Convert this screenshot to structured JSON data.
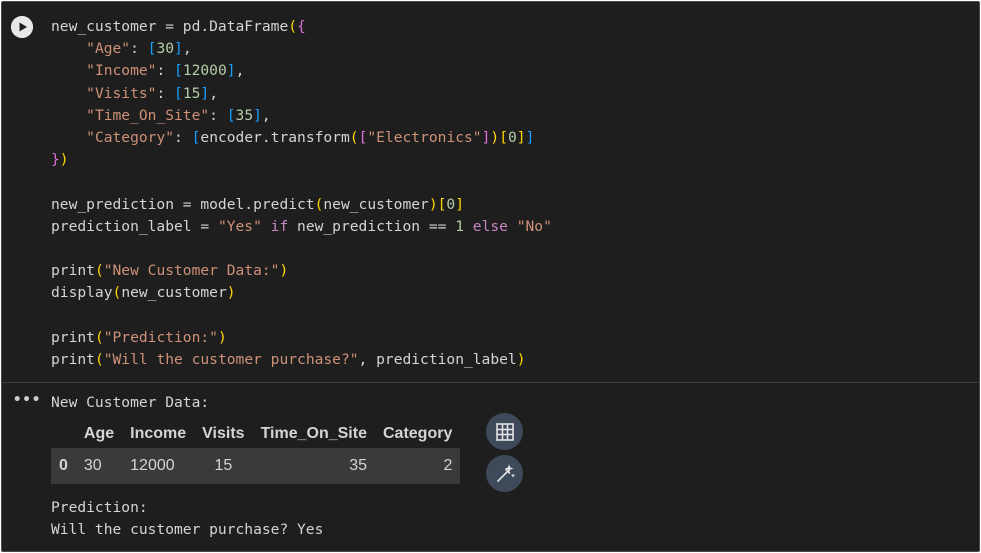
{
  "code_lines": [
    "new_customer = pd.DataFrame({",
    "    \"Age\": [30],",
    "    \"Income\": [12000],",
    "    \"Visits\": [15],",
    "    \"Time_On_Site\": [35],",
    "    \"Category\": [encoder.transform([\"Electronics\"])[0]]",
    "})",
    "",
    "new_prediction = model.predict(new_customer)[0]",
    "prediction_label = \"Yes\" if new_prediction == 1 else \"No\"",
    "",
    "print(\"New Customer Data:\")",
    "display(new_customer)",
    "",
    "print(\"Prediction:\")",
    "print(\"Will the customer purchase?\", prediction_label)"
  ],
  "output": {
    "dots": "•••",
    "header_text": "New Customer Data:",
    "table": {
      "columns": [
        "",
        "Age",
        "Income",
        "Visits",
        "Time_On_Site",
        "Category"
      ],
      "rows": [
        [
          "0",
          "30",
          "12000",
          "15",
          "35",
          "2"
        ]
      ]
    },
    "prediction_label": "Prediction:",
    "result_line": "Will the customer purchase? Yes"
  },
  "icons": {
    "run": "play-icon",
    "table": "table-grid-icon",
    "magic": "magic-wand-icon"
  },
  "colors": {
    "background": "#1e1e1e",
    "string": "#ce9178",
    "number": "#b5cea8",
    "keyword": "#c586c0",
    "table_row": "#3a3a3a",
    "tool_button": "#3e4a5a"
  }
}
